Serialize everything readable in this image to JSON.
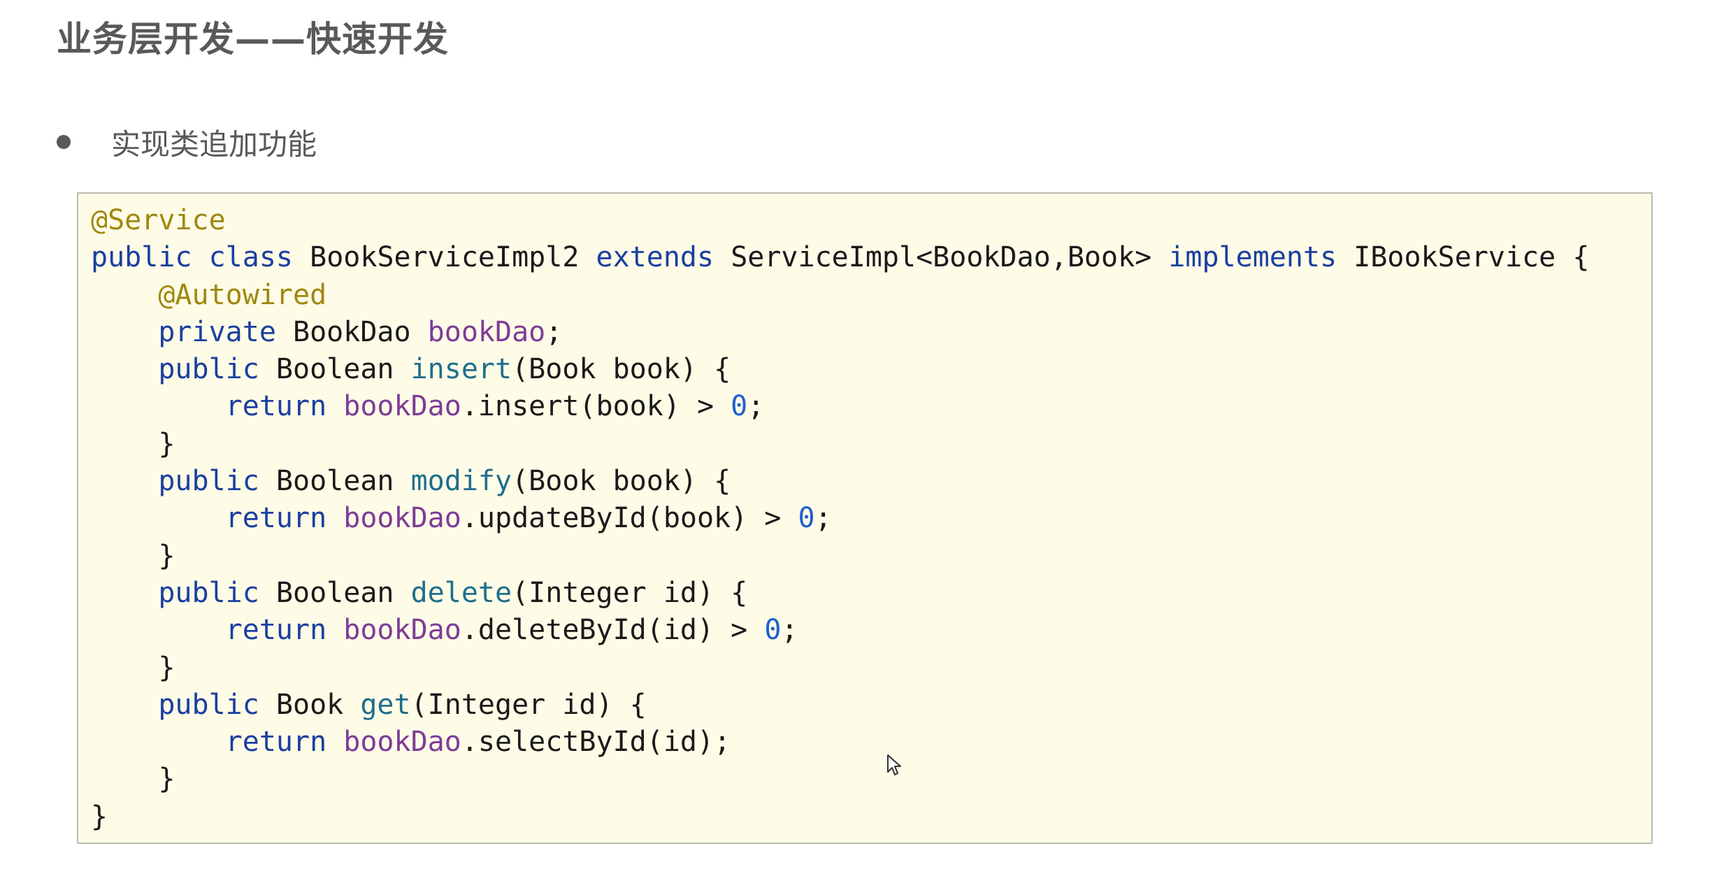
{
  "slide": {
    "title": "业务层开发——快速开发",
    "bullet_text": "实现类追加功能"
  },
  "code": {
    "tokens": {
      "service_ann": "@Service",
      "public": "public",
      "class": "class",
      "class_name": "BookServiceImpl2",
      "extends": "extends",
      "parent": "ServiceImpl<BookDao,Book>",
      "implements": "implements",
      "iface": "IBookService {",
      "autowired_ann": "@Autowired",
      "private": "private",
      "bookdao_type": "BookDao",
      "bookdao_field": "bookDao",
      "semicolon": ";",
      "boolean_type": "Boolean",
      "book_type": "Book",
      "insert_fn": "insert",
      "insert_params": "(Book book) {",
      "return": "return",
      "insert_call": ".insert(book) > ",
      "zero": "0",
      "close_brace": "}",
      "modify_fn": "modify",
      "modify_params": "(Book book) {",
      "update_call": ".updateById(book) > ",
      "delete_fn": "delete",
      "delete_params": "(Integer id) {",
      "delete_call": ".deleteById(id) > ",
      "get_fn": "get",
      "get_params": "(Integer id) {",
      "select_call": ".selectById(id);"
    }
  },
  "colors": {
    "annotation": "#9e880d",
    "keyword": "#1a3fa0",
    "method": "#1f6e8c",
    "field": "#7d3c98",
    "number": "#1f5fd1",
    "code_background": "#fefbe7"
  },
  "icons": {
    "cursor": "mouse-pointer-icon"
  }
}
